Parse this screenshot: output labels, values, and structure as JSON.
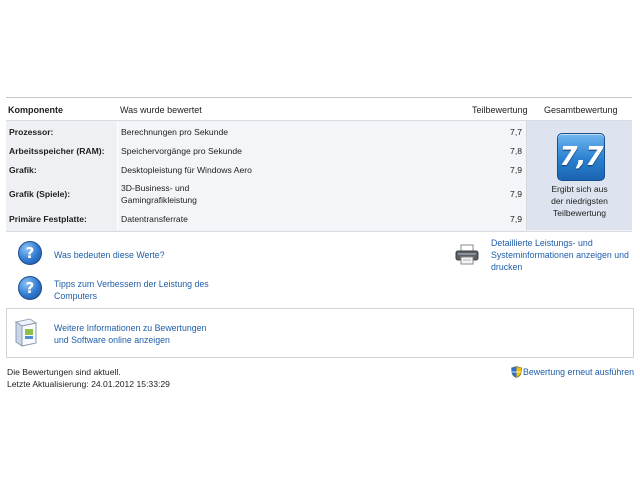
{
  "table": {
    "headers": {
      "component": "Komponente",
      "rated": "Was wurde bewertet",
      "subscore": "Teilbewertung",
      "basescore": "Gesamtbewertung"
    },
    "rows": [
      {
        "label": "Prozessor:",
        "desc": "Berechnungen pro Sekunde",
        "score": "7,7"
      },
      {
        "label": "Arbeitsspeicher (RAM):",
        "desc": "Speichervorgänge pro Sekunde",
        "score": "7,8"
      },
      {
        "label": "Grafik:",
        "desc": "Desktopleistung für Windows Aero",
        "score": "7,9"
      },
      {
        "label": "Grafik (Spiele):",
        "desc_line1": "3D-Business- und",
        "desc_line2": "Gamingrafikleistung",
        "score": "7,9"
      },
      {
        "label": "Primäre Festplatte:",
        "desc": "Datentransferrate",
        "score": "7,9"
      }
    ],
    "base_score": "7,7",
    "base_note_1": "Ergibt sich aus",
    "base_note_2": "der niedrigsten",
    "base_note_3": "Teilbewertung"
  },
  "links": {
    "meaning": "Was bedeuten diese Werte?",
    "tips_1": "Tipps zum Verbessern der Leistung des",
    "tips_2": "Computers",
    "details_1": "Detaillierte Leistungs- und",
    "details_2": "Systeminformationen anzeigen und",
    "details_3": "drucken",
    "online_1": "Weitere Informationen zu Bewertungen",
    "online_2": "und Software online anzeigen"
  },
  "status": {
    "current": "Die Bewertungen sind aktuell.",
    "last_update": "Letzte Aktualisierung: 24.01.2012 15:33:29",
    "rerun": "Bewertung erneut ausführen"
  },
  "colors": {
    "link": "#1f5ea8",
    "badge": "#2a7fd0"
  },
  "icons": [
    "help-icon",
    "printer-icon",
    "software-box-icon",
    "uac-shield-icon"
  ]
}
